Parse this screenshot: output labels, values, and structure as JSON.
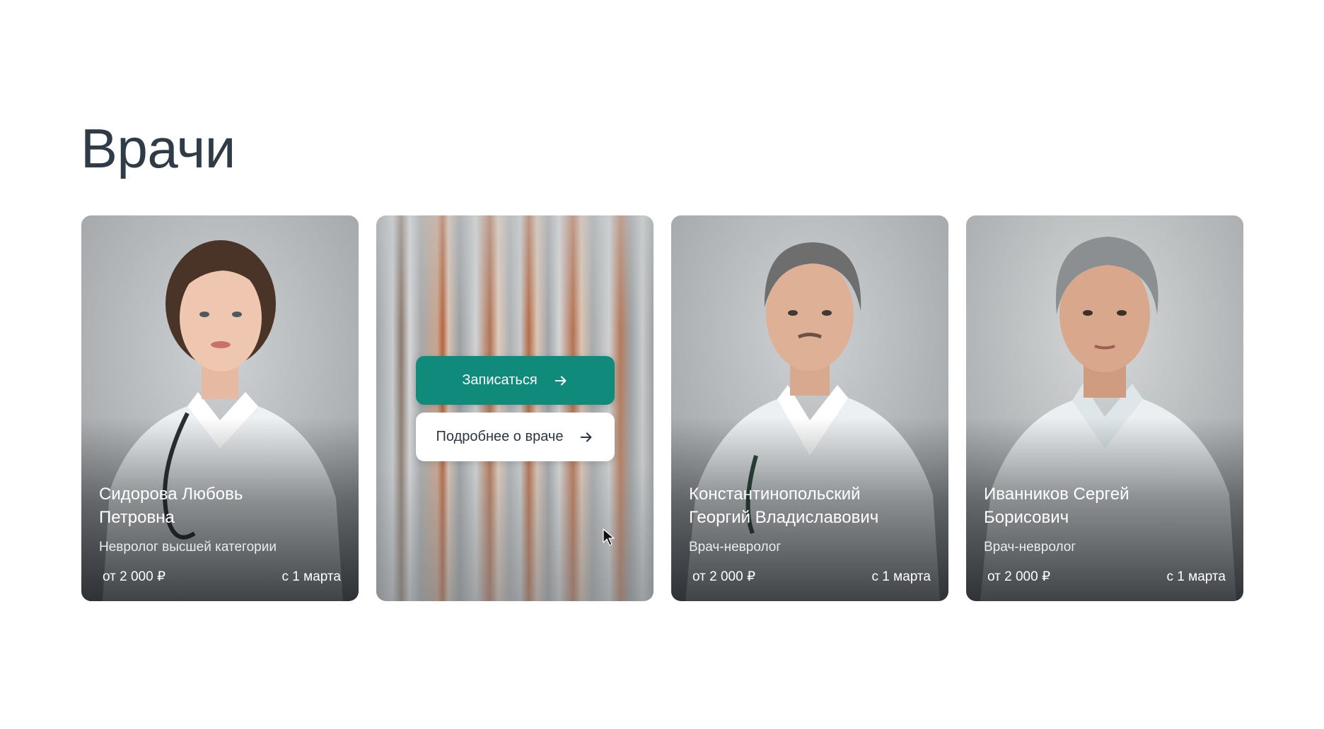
{
  "page": {
    "title": "Врачи"
  },
  "doctors": [
    {
      "name_line1": "Сидорова Любовь",
      "name_line2": "Петровна",
      "specialty": "Невролог высшей категории",
      "price": "от 2 000 ₽",
      "available": "с 1 марта"
    },
    {
      "hovered": true,
      "book_label": "Записаться",
      "details_label": "Подробнее о враче"
    },
    {
      "name_line1": "Константинопольский",
      "name_line2": "Георгий Владиславович",
      "specialty": "Врач-невролог",
      "price": "от 2 000 ₽",
      "available": "с 1 марта"
    },
    {
      "name_line1": "Иванников Сергей",
      "name_line2": "Борисович",
      "specialty": "Врач-невролог",
      "price": "от 2 000 ₽",
      "available": "с 1 марта"
    }
  ],
  "colors": {
    "title": "#2f3c48",
    "primary_button": "#108b7b",
    "secondary_button": "#ffffff"
  },
  "icons": {
    "button_arrow": "arrow-right-icon",
    "cursor": "mouse-pointer-icon"
  }
}
